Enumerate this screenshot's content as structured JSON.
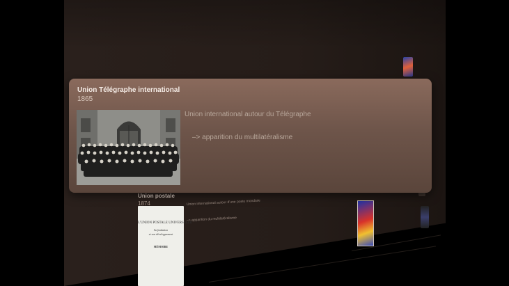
{
  "focused_event": {
    "title": "Union Télégraphe international",
    "year": "1865",
    "description": "Union international autour du Télégraphe",
    "note": "–> apparition du multilatéralisme",
    "image": "historic-group-photo"
  },
  "background_event": {
    "title": "Union postale",
    "year": "1874",
    "description": "Union international autour d'une poste mondiale",
    "note": "–> apparition du multilatéralisme",
    "document": {
      "line1": "L'UNION POSTALE UNIVERSELLE",
      "line2": "Sa fondation",
      "line3": "et son développement",
      "line4": "MÉMOIRE"
    }
  },
  "colors": {
    "background": "#000000",
    "wall": "#2a201c",
    "card": "#7a5e52",
    "card_text": "#f4ebe5",
    "card_muted_text": "#b8a79b"
  }
}
